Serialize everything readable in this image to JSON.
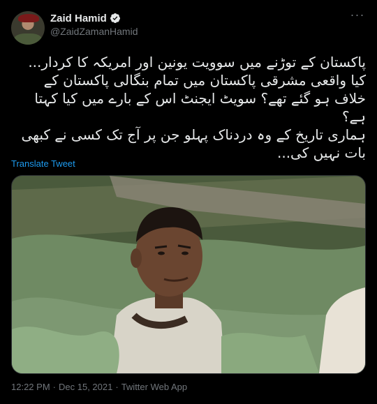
{
  "user": {
    "display_name": "Zaid Hamid",
    "handle": "@ZaidZamanHamid"
  },
  "tweet": {
    "text": "پاکستان کے توڑنے میں سوویت یونین اور امریکہ کا کردار...\nکیا واقعی مشرقی پاکستان میں تمام بنگالی پاکستان کے خلاف ہو گئے تھے؟ سویٹ ایجنٹ اس کے بارے میں کیا کہتا ہے؟\nہماری تاریخ کے وہ دردناک پہلو جن پر آج تک کسی نے کبھی بات نہیں کی..."
  },
  "translate_label": "Translate Tweet",
  "meta": {
    "time": "12:22 PM",
    "sep1": "·",
    "date": "Dec 15, 2021",
    "sep2": "·",
    "source": "Twitter Web App"
  },
  "icons": {
    "verified": "verified-badge-icon",
    "more": "more-options-icon"
  },
  "colors": {
    "background": "#000000",
    "text": "#e7e9ea",
    "secondary": "#71767b",
    "link": "#1d9bf0"
  }
}
